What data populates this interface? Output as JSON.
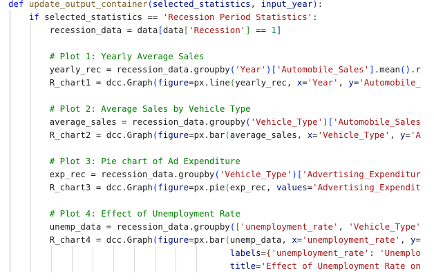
{
  "editor": {
    "lines": [
      [
        {
          "t": "def",
          "c": "kw"
        },
        {
          "t": " "
        },
        {
          "t": "update_output_container",
          "c": "fn"
        },
        {
          "t": "(",
          "c": "br1"
        },
        {
          "t": "selected_statistics",
          "c": "var"
        },
        {
          "t": ", "
        },
        {
          "t": "input_year",
          "c": "var"
        },
        {
          "t": ")",
          "c": "br1"
        },
        {
          "t": ":"
        }
      ],
      [
        {
          "t": "    "
        },
        {
          "t": "if",
          "c": "kw"
        },
        {
          "t": " selected_statistics == "
        },
        {
          "t": "'Recession Period Statistics'",
          "c": "str"
        },
        {
          "t": ":"
        }
      ],
      [
        {
          "t": "        recession_data = data"
        },
        {
          "t": "[",
          "c": "br1"
        },
        {
          "t": "data"
        },
        {
          "t": "[",
          "c": "br2"
        },
        {
          "t": "'Recession'",
          "c": "str"
        },
        {
          "t": "]",
          "c": "br2"
        },
        {
          "t": " == "
        },
        {
          "t": "1",
          "c": "num"
        },
        {
          "t": "]",
          "c": "br1"
        }
      ],
      [],
      [
        {
          "t": "        "
        },
        {
          "t": "# Plot 1: Yearly Average Sales",
          "c": "cm"
        }
      ],
      [
        {
          "t": "        yearly_rec = recession_data.groupby"
        },
        {
          "t": "(",
          "c": "br1"
        },
        {
          "t": "'Year'",
          "c": "str"
        },
        {
          "t": ")",
          "c": "br1"
        },
        {
          "t": "[",
          "c": "br1"
        },
        {
          "t": "'Automobile_Sales'",
          "c": "str"
        },
        {
          "t": "]",
          "c": "br1"
        },
        {
          "t": ".mean"
        },
        {
          "t": "()",
          "c": "br1"
        },
        {
          "t": ".r"
        }
      ],
      [
        {
          "t": "        R_chart1 = dcc.Graph"
        },
        {
          "t": "(",
          "c": "br1"
        },
        {
          "t": "figure",
          "c": "var"
        },
        {
          "t": "=px.line"
        },
        {
          "t": "(",
          "c": "br2"
        },
        {
          "t": "yearly_rec, "
        },
        {
          "t": "x",
          "c": "var"
        },
        {
          "t": "="
        },
        {
          "t": "'Year'",
          "c": "str"
        },
        {
          "t": ", "
        },
        {
          "t": "y",
          "c": "var"
        },
        {
          "t": "="
        },
        {
          "t": "'Automobile_",
          "c": "str"
        }
      ],
      [],
      [
        {
          "t": "        "
        },
        {
          "t": "# Plot 2: Average Sales by Vehicle Type",
          "c": "cm"
        }
      ],
      [
        {
          "t": "        average_sales = recession_data.groupby"
        },
        {
          "t": "(",
          "c": "br1"
        },
        {
          "t": "'Vehicle_Type'",
          "c": "str"
        },
        {
          "t": ")",
          "c": "br1"
        },
        {
          "t": "[",
          "c": "br1"
        },
        {
          "t": "'Automobile_Sales",
          "c": "str"
        }
      ],
      [
        {
          "t": "        R_chart2 = dcc.Graph"
        },
        {
          "t": "(",
          "c": "br1"
        },
        {
          "t": "figure",
          "c": "var"
        },
        {
          "t": "=px.bar"
        },
        {
          "t": "(",
          "c": "br2"
        },
        {
          "t": "average_sales, "
        },
        {
          "t": "x",
          "c": "var"
        },
        {
          "t": "="
        },
        {
          "t": "'Vehicle_Type'",
          "c": "str"
        },
        {
          "t": ", "
        },
        {
          "t": "y",
          "c": "var"
        },
        {
          "t": "="
        },
        {
          "t": "'A",
          "c": "str"
        }
      ],
      [],
      [
        {
          "t": "        "
        },
        {
          "t": "# Plot 3: Pie chart of Ad Expenditure",
          "c": "cm"
        }
      ],
      [
        {
          "t": "        exp_rec = recession_data.groupby"
        },
        {
          "t": "(",
          "c": "br1"
        },
        {
          "t": "'Vehicle_Type'",
          "c": "str"
        },
        {
          "t": ")",
          "c": "br1"
        },
        {
          "t": "[",
          "c": "br1"
        },
        {
          "t": "'Advertising_Expenditur",
          "c": "str"
        }
      ],
      [
        {
          "t": "        R_chart3 = dcc.Graph"
        },
        {
          "t": "(",
          "c": "br1"
        },
        {
          "t": "figure",
          "c": "var"
        },
        {
          "t": "=px.pie"
        },
        {
          "t": "(",
          "c": "br2"
        },
        {
          "t": "exp_rec, "
        },
        {
          "t": "values",
          "c": "var"
        },
        {
          "t": "="
        },
        {
          "t": "'Advertising_Expendit",
          "c": "str"
        }
      ],
      [],
      [
        {
          "t": "        "
        },
        {
          "t": "# Plot 4: Effect of Unemployment Rate",
          "c": "cm"
        }
      ],
      [
        {
          "t": "        unemp_data = recession_data.groupby"
        },
        {
          "t": "(",
          "c": "br1"
        },
        {
          "t": "[",
          "c": "br2"
        },
        {
          "t": "'unemployment_rate'",
          "c": "str"
        },
        {
          "t": ", "
        },
        {
          "t": "'Vehicle_Type'",
          "c": "str"
        }
      ],
      [
        {
          "t": "        R_chart4 = dcc.Graph"
        },
        {
          "t": "(",
          "c": "br1"
        },
        {
          "t": "figure",
          "c": "var"
        },
        {
          "t": "=px.bar"
        },
        {
          "t": "(",
          "c": "br2"
        },
        {
          "t": "unemp_data, "
        },
        {
          "t": "x",
          "c": "var"
        },
        {
          "t": "="
        },
        {
          "t": "'unemployment_rate'",
          "c": "str"
        },
        {
          "t": ", "
        },
        {
          "t": "y",
          "c": "var"
        },
        {
          "t": "="
        }
      ],
      [
        {
          "t": "                                           "
        },
        {
          "t": "labels",
          "c": "var"
        },
        {
          "t": "="
        },
        {
          "t": "{",
          "c": "br3"
        },
        {
          "t": "'unemployment_rate'",
          "c": "str"
        },
        {
          "t": ": "
        },
        {
          "t": "'Unemplo",
          "c": "str"
        }
      ],
      [
        {
          "t": "                                           "
        },
        {
          "t": "title",
          "c": "var"
        },
        {
          "t": "="
        },
        {
          "t": "'Effect of Unemployment Rate on",
          "c": "str"
        }
      ]
    ]
  }
}
